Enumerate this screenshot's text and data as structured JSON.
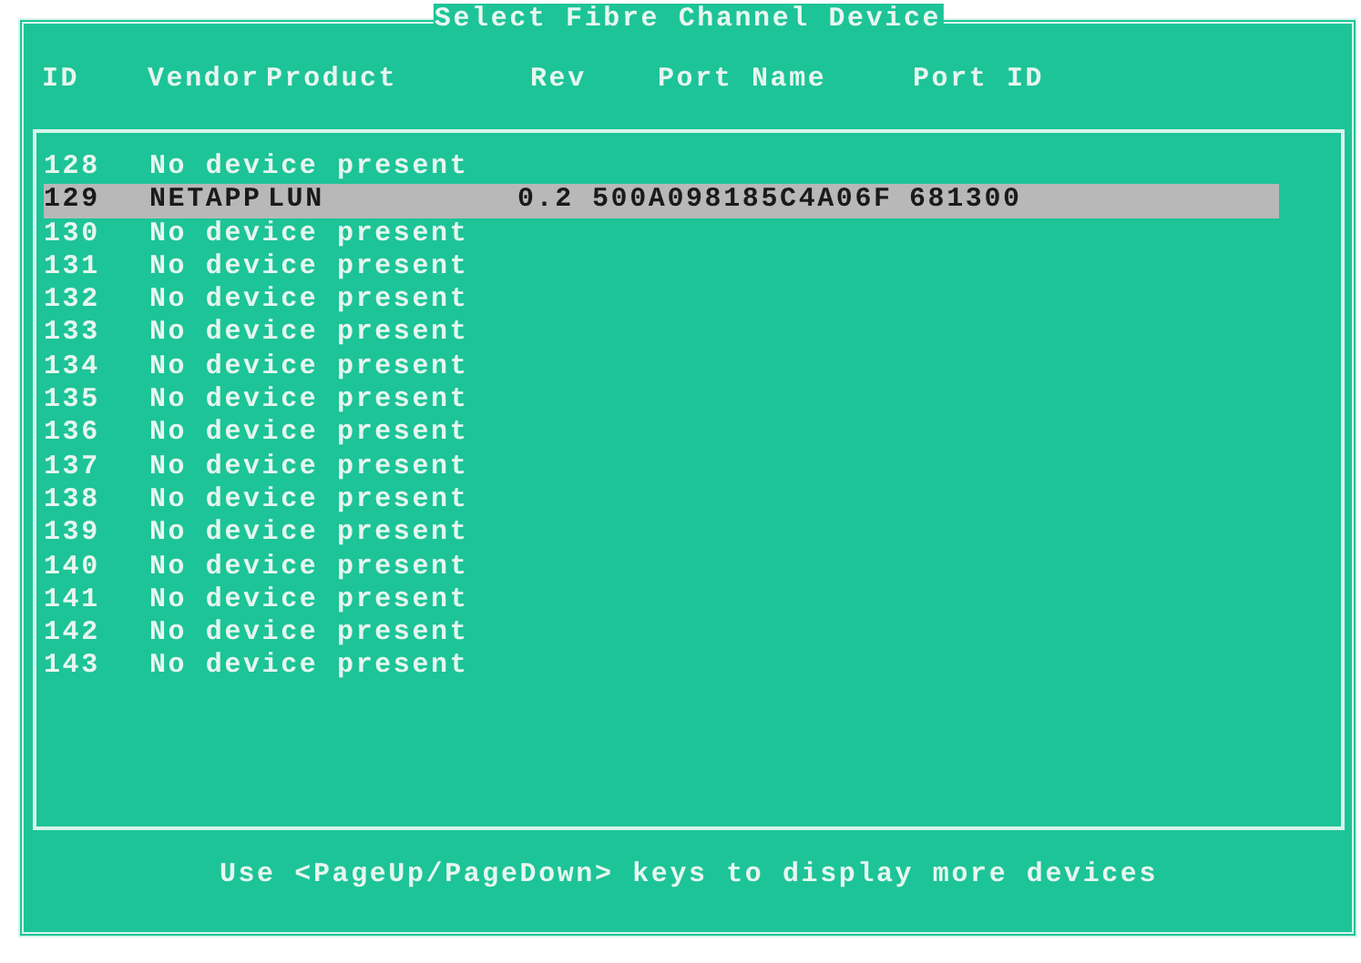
{
  "dialog": {
    "title": "Select Fibre Channel Device",
    "columns": [
      "ID",
      "Vendor",
      "Product",
      "Rev",
      "Port Name",
      "Port ID"
    ],
    "rows": [
      {
        "kind": "empty",
        "id": "128",
        "text": "No device present",
        "selected": false
      },
      {
        "kind": "device",
        "id": "129",
        "vendor": "NETAPP",
        "product": "LUN",
        "rev": "0.2",
        "port_name": "500A098185C4A06F",
        "port_id": "681300",
        "selected": true
      },
      {
        "kind": "empty",
        "id": "130",
        "text": "No device present",
        "selected": false
      },
      {
        "kind": "empty",
        "id": "131",
        "text": "No device present",
        "selected": false
      },
      {
        "kind": "empty",
        "id": "132",
        "text": "No device present",
        "selected": false
      },
      {
        "kind": "empty",
        "id": "133",
        "text": "No device present",
        "selected": false
      },
      {
        "kind": "empty",
        "id": "134",
        "text": "No device present",
        "selected": false
      },
      {
        "kind": "empty",
        "id": "135",
        "text": "No device present",
        "selected": false
      },
      {
        "kind": "empty",
        "id": "136",
        "text": "No device present",
        "selected": false
      },
      {
        "kind": "empty",
        "id": "137",
        "text": "No device present",
        "selected": false
      },
      {
        "kind": "empty",
        "id": "138",
        "text": "No device present",
        "selected": false
      },
      {
        "kind": "empty",
        "id": "139",
        "text": "No device present",
        "selected": false
      },
      {
        "kind": "empty",
        "id": "140",
        "text": "No device present",
        "selected": false
      },
      {
        "kind": "empty",
        "id": "141",
        "text": "No device present",
        "selected": false
      },
      {
        "kind": "empty",
        "id": "142",
        "text": "No device present",
        "selected": false
      },
      {
        "kind": "empty",
        "id": "143",
        "text": "No device present",
        "selected": false
      }
    ],
    "hint": "Use <PageUp/PageDown> keys to display more devices"
  }
}
